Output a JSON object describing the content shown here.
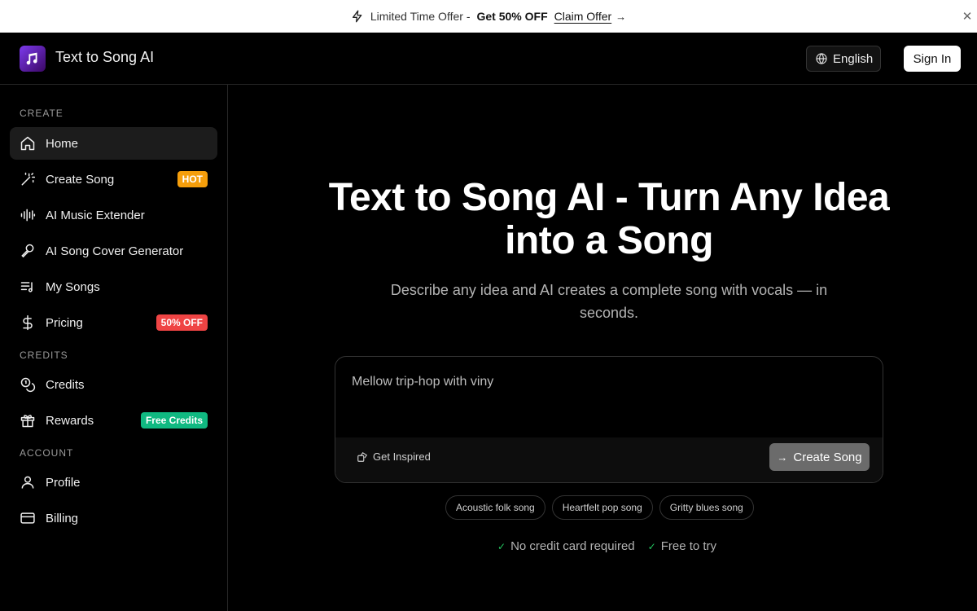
{
  "promo": {
    "prefix": "Limited Time Offer -",
    "deal": "Get 50% OFF",
    "claim": "Claim Offer",
    "arrow": "→",
    "close": "✕"
  },
  "header": {
    "brand": "Text to Song AI",
    "language": "English",
    "sign_in": "Sign In"
  },
  "sidebar": {
    "sections": {
      "create": "CREATE",
      "credits": "CREDITS",
      "account": "ACCOUNT"
    },
    "items": [
      {
        "label": "Home",
        "icon": "home-icon",
        "active": true
      },
      {
        "label": "Create Song",
        "icon": "magic-wand-icon",
        "badge": "HOT",
        "badge_color": "#f59e0b"
      },
      {
        "label": "AI Music Extender",
        "icon": "audio-wave-icon"
      },
      {
        "label": "AI Song Cover Generator",
        "icon": "microphone-icon"
      },
      {
        "label": "My Songs",
        "icon": "music-list-icon"
      },
      {
        "label": "Pricing",
        "icon": "dollar-icon",
        "badge": "50% OFF",
        "badge_color": "#ef4444"
      },
      {
        "label": "Credits",
        "icon": "coins-icon"
      },
      {
        "label": "Rewards",
        "icon": "gift-icon",
        "badge": "Free Credits",
        "badge_color": "#10b981"
      },
      {
        "label": "Profile",
        "icon": "user-icon"
      },
      {
        "label": "Billing",
        "icon": "credit-card-icon"
      }
    ]
  },
  "main": {
    "title_line1": "Text to Song AI - Turn Any Idea",
    "title_line2": "into a Song",
    "subtitle": "Describe any idea and AI creates a complete song with vocals — in seconds.",
    "prompt_value": "Mellow trip-hop with viny",
    "get_inspired": "Get Inspired",
    "create_button": "Create Song",
    "chips": [
      "Acoustic folk song",
      "Heartfelt pop song",
      "Gritty blues song"
    ],
    "checks": [
      "No credit card required",
      "Free to try"
    ]
  }
}
